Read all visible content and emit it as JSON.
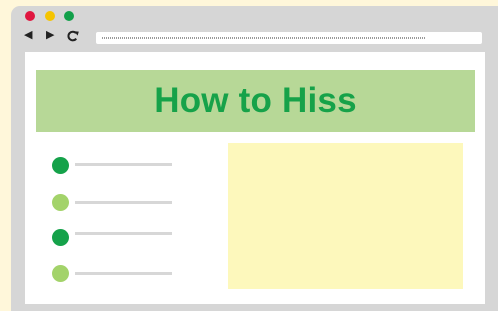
{
  "browser": {
    "window_controls": [
      {
        "name": "close",
        "color": "#e0163f"
      },
      {
        "name": "minimize",
        "color": "#f5c400"
      },
      {
        "name": "zoom",
        "color": "#12a04a"
      }
    ],
    "nav_icons": {
      "back": "◀",
      "forward": "▶",
      "reload": "C"
    }
  },
  "page": {
    "banner_title": "How to Hiss",
    "banner_color": "#b7d897",
    "title_color": "#16a249",
    "list_items": [
      {
        "bullet_color": "#15a24a"
      },
      {
        "bullet_color": "#a3d36a"
      },
      {
        "bullet_color": "#15a24a"
      },
      {
        "bullet_color": "#a3d36a"
      }
    ],
    "image_placeholder_color": "#fdf8bc"
  }
}
